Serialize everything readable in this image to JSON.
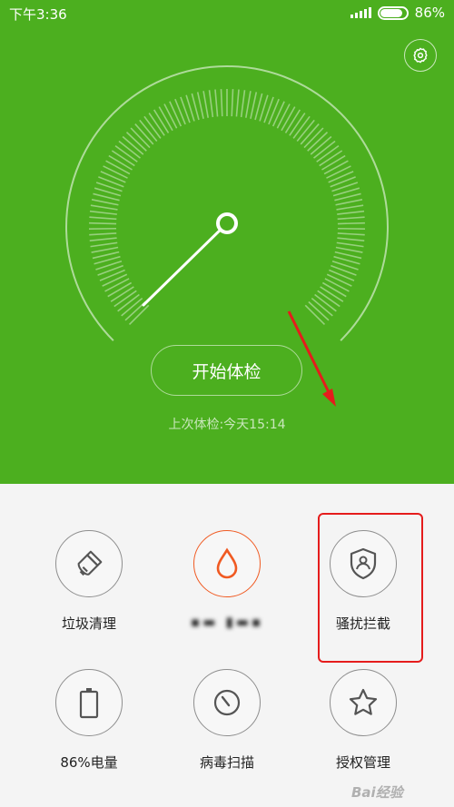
{
  "status_bar": {
    "time": "下午3:36",
    "battery": "86%"
  },
  "main": {
    "start_button": "开始体检",
    "last_check": "上次体检:今天15:14"
  },
  "tools": [
    {
      "label": "垃圾清理",
      "icon": "broom-icon"
    },
    {
      "label": "▪▬ ▮▬▪",
      "icon": "water-drop-icon"
    },
    {
      "label": "骚扰拦截",
      "icon": "shield-user-icon"
    },
    {
      "label": "86%电量",
      "icon": "battery-icon"
    },
    {
      "label": "病毒扫描",
      "icon": "stopwatch-icon"
    },
    {
      "label": "授权管理",
      "icon": "star-icon"
    }
  ],
  "watermark": "Bai经验",
  "colors": {
    "primary_green": "#4caf1f",
    "accent_orange": "#f05a22",
    "highlight_red": "#e51c1c"
  }
}
